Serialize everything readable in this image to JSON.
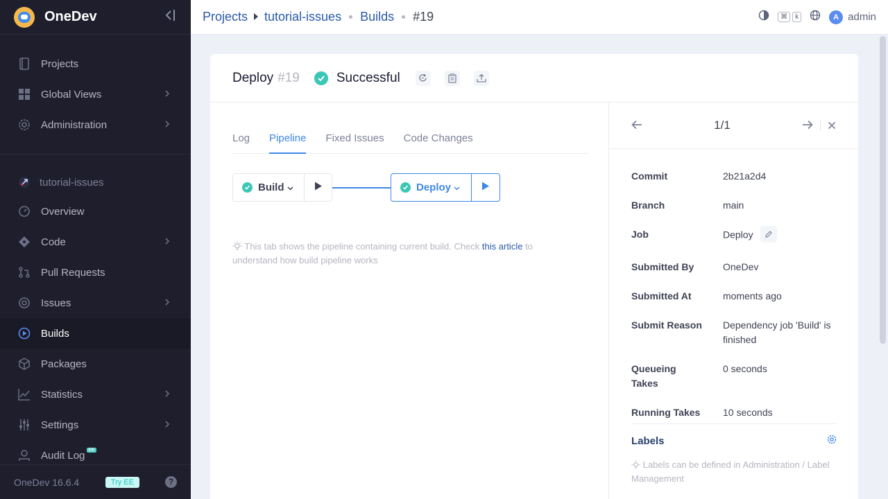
{
  "app": {
    "name": "OneDev",
    "version": "OneDev 16.6.4",
    "try_ee": "Try EE",
    "help": "?"
  },
  "sidebar": {
    "global": [
      {
        "label": "Projects",
        "icon": "projects-icon"
      },
      {
        "label": "Global Views",
        "icon": "global-views-icon"
      },
      {
        "label": "Administration",
        "icon": "administration-icon"
      }
    ],
    "project_name": "tutorial-issues",
    "project_items": [
      {
        "label": "Overview",
        "icon": "overview-icon"
      },
      {
        "label": "Code",
        "icon": "code-icon"
      },
      {
        "label": "Pull Requests",
        "icon": "pull-requests-icon"
      },
      {
        "label": "Issues",
        "icon": "issues-icon"
      },
      {
        "label": "Builds",
        "icon": "builds-icon",
        "active": true
      },
      {
        "label": "Packages",
        "icon": "packages-icon"
      },
      {
        "label": "Statistics",
        "icon": "statistics-icon"
      },
      {
        "label": "Settings",
        "icon": "settings-icon"
      },
      {
        "label": "Audit Log",
        "icon": "audit-log-icon",
        "badge": "EE"
      }
    ]
  },
  "breadcrumb": {
    "projects": "Projects",
    "project": "tutorial-issues",
    "builds": "Builds",
    "current": "#19"
  },
  "topbar": {
    "shortcut_1": "⌘",
    "shortcut_2": "k",
    "avatar_initial": "A",
    "user": "admin"
  },
  "build": {
    "job": "Deploy",
    "number": "#19",
    "status": "Successful"
  },
  "tabs": [
    "Log",
    "Pipeline",
    "Fixed Issues",
    "Code Changes"
  ],
  "active_tab": "Pipeline",
  "pipeline": {
    "job1": "Build",
    "job2": "Deploy"
  },
  "tip": {
    "before": "This tab shows the pipeline containing current build. Check ",
    "link": "this article",
    "after": " to understand how build pipeline works"
  },
  "nav": {
    "count": "1/1"
  },
  "properties": [
    {
      "key": "Commit",
      "value": "2b21a2d4"
    },
    {
      "key": "Branch",
      "value": "main"
    },
    {
      "key": "Job",
      "value": "Deploy"
    },
    {
      "key": "Submitted By",
      "value": "OneDev"
    },
    {
      "key": "Submitted At",
      "value": "moments ago"
    },
    {
      "key": "Submit Reason",
      "value": "Dependency job 'Build' is finished"
    },
    {
      "key": "Queueing Takes",
      "value": "0 seconds"
    },
    {
      "key": "Running Takes",
      "value": "10 seconds"
    }
  ],
  "labels": {
    "title": "Labels",
    "tip": "Labels can be defined in Administration / Label Management"
  },
  "colors": {
    "accent": "#3f87e4",
    "success": "#3cc6b6",
    "sidebar_bg": "#1e1e2d"
  }
}
